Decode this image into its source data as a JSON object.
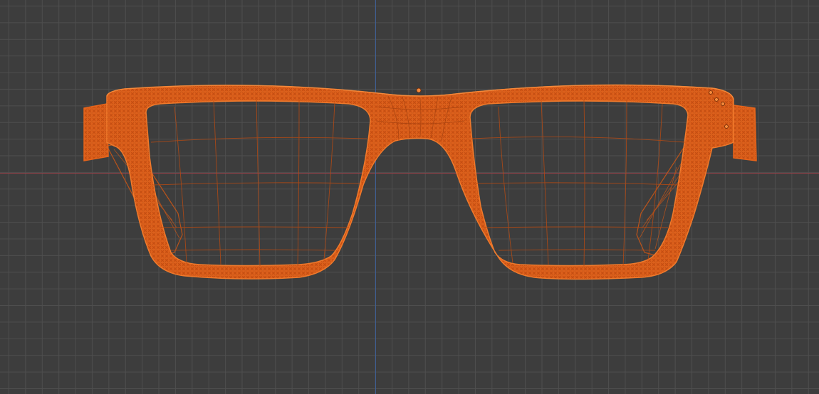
{
  "viewport": {
    "background_color": "#3d3d3d",
    "grid_color": "#4e4e4e",
    "x_axis_color": "#9a4048",
    "y_axis_color": "#3d5f95"
  },
  "object": {
    "kind": "glasses-frame-mesh",
    "display": "wireframe",
    "selected": true,
    "selection_color": "#e8641a",
    "wire_color": "#c2501a"
  }
}
